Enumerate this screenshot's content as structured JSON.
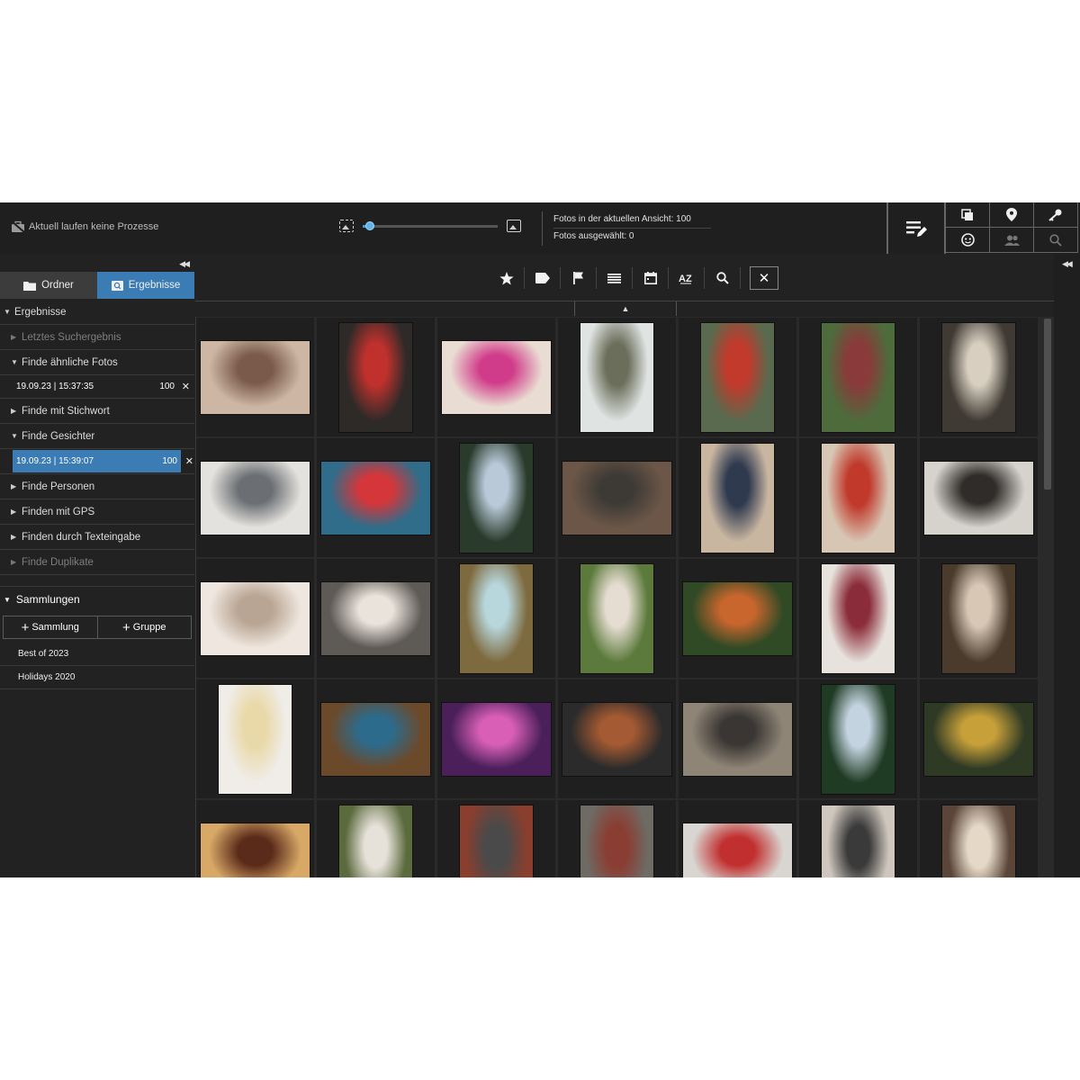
{
  "topbar": {
    "process_status": "Aktuell laufen keine Prozesse",
    "zoom_level": 0.05,
    "photos_in_view": "Fotos in der aktuellen Ansicht: 100",
    "photos_selected": "Fotos ausgewählt: 0",
    "tools": [
      "edit-icon",
      "duplicate-icon",
      "map-pin-icon",
      "key-icon",
      "face-icon",
      "people-icon",
      "search-icon"
    ]
  },
  "left": {
    "tabs": [
      {
        "label": "Ordner",
        "icon": "folder-icon",
        "active": false
      },
      {
        "label": "Ergebnisse",
        "icon": "search-results-icon",
        "active": true
      }
    ],
    "tree": {
      "ergebnisse": "Ergebnisse",
      "letztes": "Letztes Suchergebnis",
      "aehnliche": "Finde ähnliche Fotos",
      "aehnliche_entry": {
        "date": "19.09.23 | 15:37:35",
        "count": "100"
      },
      "stichwort": "Finde mit Stichwort",
      "gesichter": "Finde Gesichter",
      "gesichter_entry": {
        "date": "19.09.23 | 15:39:07",
        "count": "100"
      },
      "personen": "Finde Personen",
      "gps": "Finden mit GPS",
      "texteingabe": "Finden durch Texteingabe",
      "duplikate": "Finde Duplikate"
    },
    "collections": {
      "heading": "Sammlungen",
      "add_collection": "Sammlung",
      "add_group": "Gruppe",
      "items": [
        "Best of 2023",
        "Holidays 2020"
      ]
    }
  },
  "filterbar": {
    "icons": [
      "star-icon",
      "tag-icon",
      "flag-icon",
      "list-icon",
      "calendar-icon",
      "sort-az-icon",
      "magnifier-icon"
    ],
    "close": "✕"
  },
  "photos": [
    {
      "o": "l",
      "c": [
        "#cdb7a4",
        "#7a5a4a"
      ]
    },
    {
      "o": "p",
      "c": [
        "#2e2a28",
        "#c0312d"
      ]
    },
    {
      "o": "l",
      "c": [
        "#e9dcd2",
        "#d13c8a"
      ]
    },
    {
      "o": "p",
      "c": [
        "#dfe3e2",
        "#6b6e5a"
      ]
    },
    {
      "o": "p",
      "c": [
        "#5a6a4e",
        "#c23a2c"
      ]
    },
    {
      "o": "p",
      "c": [
        "#4e6b3c",
        "#8a3a3a"
      ]
    },
    {
      "o": "p",
      "c": [
        "#3f3a34",
        "#d8cfc0"
      ]
    },
    {
      "o": "l",
      "c": [
        "#e4e2de",
        "#6b6f73"
      ]
    },
    {
      "o": "l",
      "c": [
        "#2f6d8a",
        "#d4363a"
      ]
    },
    {
      "o": "p",
      "c": [
        "#2a3b2c",
        "#b9c9d8"
      ]
    },
    {
      "o": "l",
      "c": [
        "#6b5647",
        "#3d3a36"
      ]
    },
    {
      "o": "p",
      "c": [
        "#c9b6a1",
        "#2f3a4f"
      ]
    },
    {
      "o": "p",
      "c": [
        "#d8c6b4",
        "#c0392b"
      ]
    },
    {
      "o": "l",
      "c": [
        "#d6d2cc",
        "#2f2c2a"
      ]
    },
    {
      "o": "l",
      "c": [
        "#efe7df",
        "#b9a593"
      ]
    },
    {
      "o": "l",
      "c": [
        "#5e5a55",
        "#e9e3db"
      ]
    },
    {
      "o": "p",
      "c": [
        "#7d6a3e",
        "#b8d7dd"
      ]
    },
    {
      "o": "p",
      "c": [
        "#5c7a3b",
        "#e6ddd2"
      ]
    },
    {
      "o": "l",
      "c": [
        "#2f4a25",
        "#c9662d"
      ]
    },
    {
      "o": "p",
      "c": [
        "#e7e2dc",
        "#8b2c3a"
      ]
    },
    {
      "o": "p",
      "c": [
        "#4a3b2c",
        "#d8c7b5"
      ]
    },
    {
      "o": "p",
      "c": [
        "#f0ede9",
        "#e9d9a9"
      ]
    },
    {
      "o": "l",
      "c": [
        "#6b4a2c",
        "#2d6b8c"
      ]
    },
    {
      "o": "l",
      "c": [
        "#4a1f5a",
        "#d85fb5"
      ]
    },
    {
      "o": "l",
      "c": [
        "#2b2b2b",
        "#a45a32"
      ]
    },
    {
      "o": "l",
      "c": [
        "#8f8577",
        "#3a3633"
      ]
    },
    {
      "o": "p",
      "c": [
        "#1f3b24",
        "#c3d3df"
      ]
    },
    {
      "o": "l",
      "c": [
        "#2f3a25",
        "#c7a03a"
      ]
    },
    {
      "o": "l",
      "c": [
        "#d7a866",
        "#5a2a1a"
      ]
    },
    {
      "o": "p",
      "c": [
        "#5c6b3e",
        "#e6e1d9"
      ]
    },
    {
      "o": "p",
      "c": [
        "#8a3e2e",
        "#4a4a4a"
      ]
    },
    {
      "o": "p",
      "c": [
        "#6e6a64",
        "#8a3e33"
      ]
    },
    {
      "o": "l",
      "c": [
        "#d9d6d2",
        "#c12f2f"
      ]
    },
    {
      "o": "p",
      "c": [
        "#cfc7bd",
        "#3a3a3a"
      ]
    },
    {
      "o": "p",
      "c": [
        "#5a4538",
        "#e5d8c7"
      ]
    }
  ]
}
